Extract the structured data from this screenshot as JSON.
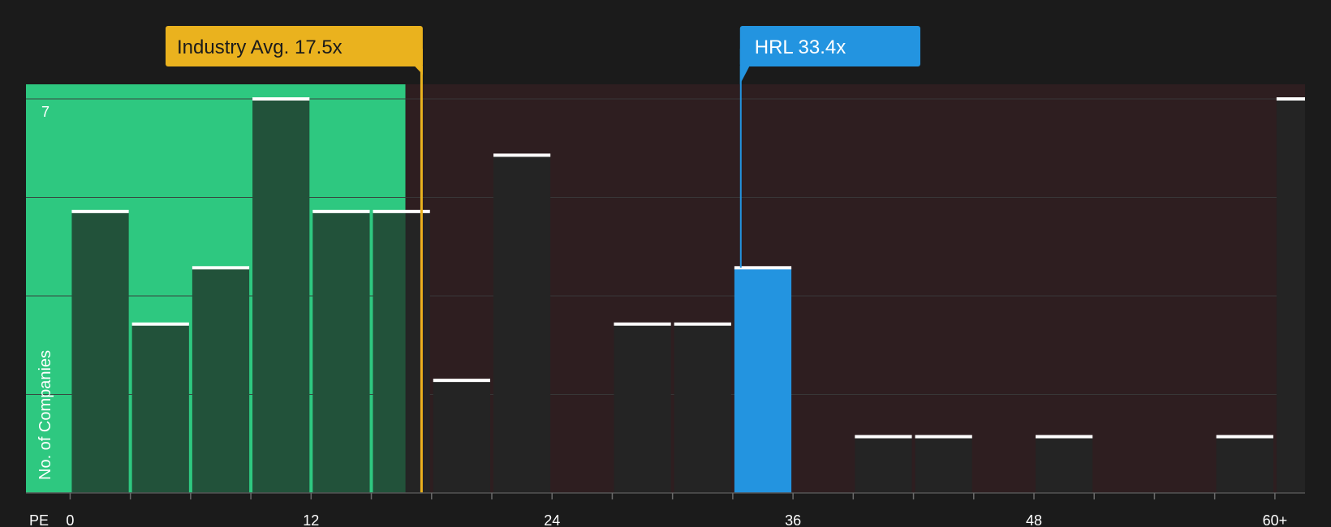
{
  "colors": {
    "background": "#1b1b1b",
    "undervalued_region": "#2ec880",
    "overvalued_region": "#2e1e20",
    "bar": "#242424",
    "bar_in_green": "#22523a",
    "highlight_bar": "#2394e0",
    "industry_marker": "#eab21e",
    "company_marker": "#2394e0",
    "bar_cap": "#ffffff",
    "gridline": "#3a3a3a",
    "text": "#ffffff"
  },
  "chart_data": {
    "type": "bar",
    "xlabel": "PE",
    "ylabel": "No. of Companies",
    "ylim": [
      0,
      7
    ],
    "y_tick_labels": [
      "7"
    ],
    "x_ticks": [
      "0",
      "12",
      "24",
      "36",
      "48",
      "60+"
    ],
    "x_tick_values": [
      0,
      12,
      24,
      36,
      48,
      60
    ],
    "x_range": [
      -2.2,
      61.5
    ],
    "bin_width": 3,
    "bins": [
      {
        "start": 0,
        "count": 5
      },
      {
        "start": 3,
        "count": 3
      },
      {
        "start": 6,
        "count": 4
      },
      {
        "start": 9,
        "count": 7
      },
      {
        "start": 12,
        "count": 5
      },
      {
        "start": 15,
        "count": 5
      },
      {
        "start": 18,
        "count": 2
      },
      {
        "start": 21,
        "count": 6
      },
      {
        "start": 24,
        "count": 0
      },
      {
        "start": 27,
        "count": 3
      },
      {
        "start": 30,
        "count": 3
      },
      {
        "start": 33,
        "count": 4,
        "highlight": true
      },
      {
        "start": 36,
        "count": 0
      },
      {
        "start": 39,
        "count": 1
      },
      {
        "start": 42,
        "count": 1
      },
      {
        "start": 45,
        "count": 0
      },
      {
        "start": 48,
        "count": 1
      },
      {
        "start": 51,
        "count": 0
      },
      {
        "start": 54,
        "count": 0
      },
      {
        "start": 57,
        "count": 1
      },
      {
        "start": 60,
        "count": 7
      }
    ],
    "undervalued_until": 16.7,
    "industry_avg": {
      "label": "Industry Avg. 17.5x",
      "value": 17.5
    },
    "company": {
      "label": "HRL 33.4x",
      "value": 33.4
    }
  }
}
